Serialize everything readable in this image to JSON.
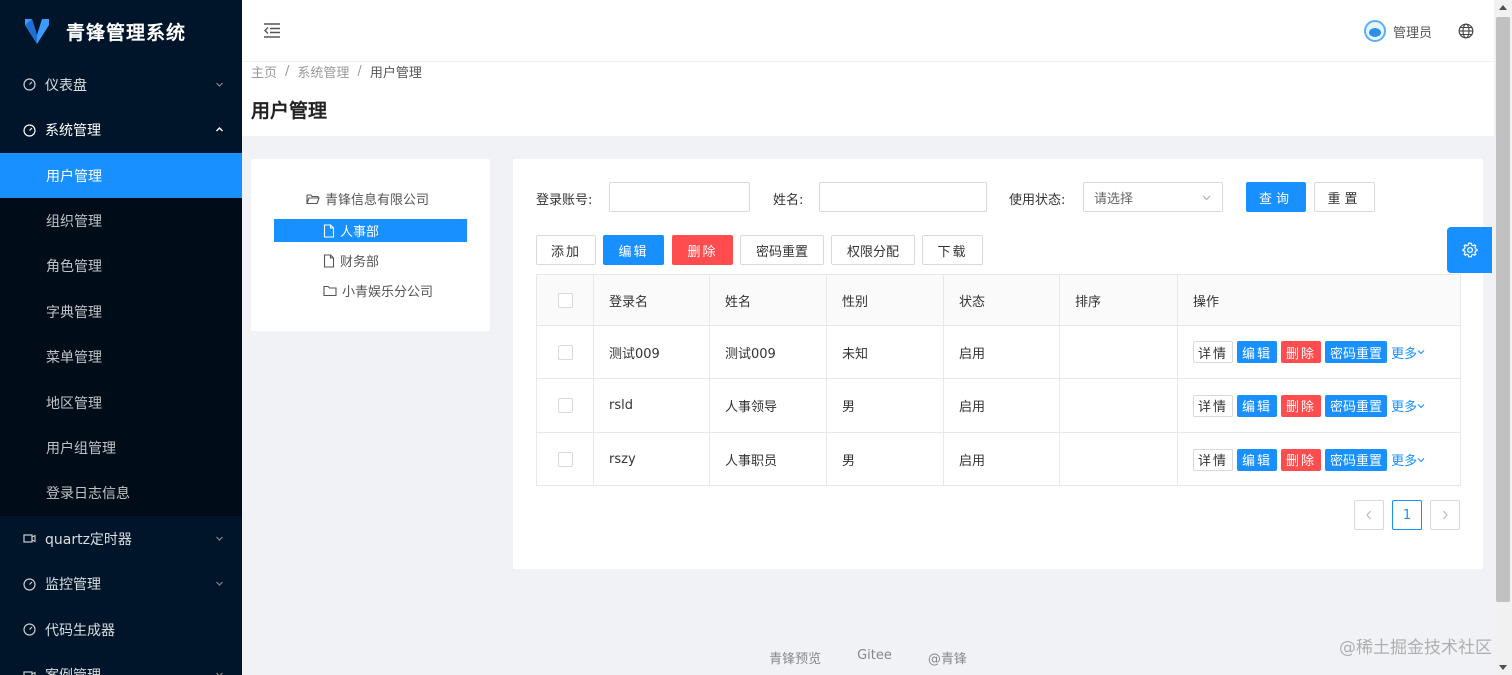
{
  "app": {
    "title": "青锋管理系统"
  },
  "sidebar": {
    "menus": [
      {
        "label": "仪表盘",
        "icon": "dashboard-icon",
        "expanded": false
      },
      {
        "label": "系统管理",
        "icon": "dashboard-icon",
        "expanded": true,
        "children": [
          "用户管理",
          "组织管理",
          "角色管理",
          "字典管理",
          "菜单管理",
          "地区管理",
          "用户组管理",
          "登录日志信息"
        ],
        "active_child": "用户管理"
      },
      {
        "label": "quartz定时器",
        "icon": "video-icon",
        "expanded": false
      },
      {
        "label": "监控管理",
        "icon": "dashboard-icon",
        "expanded": false
      },
      {
        "label": "代码生成器",
        "icon": "dashboard-icon",
        "expanded": false
      },
      {
        "label": "案例管理",
        "icon": "video-icon",
        "expanded": false
      }
    ]
  },
  "header": {
    "user_name": "管理员"
  },
  "breadcrumb": [
    "主页",
    "系统管理",
    "用户管理"
  ],
  "page_title": "用户管理",
  "tree": {
    "root": "青锋信息有限公司",
    "children": [
      "人事部",
      "财务部",
      "小青娱乐分公司"
    ],
    "selected": "人事部"
  },
  "search": {
    "account_label": "登录账号:",
    "account_value": "",
    "name_label": "姓名:",
    "name_value": "",
    "status_label": "使用状态:",
    "status_placeholder": "请选择",
    "query_label": "查询",
    "reset_label": "重置"
  },
  "toolbar": {
    "add_label": "添加",
    "edit_label": "编辑",
    "delete_label": "删除",
    "reset_pwd_label": "密码重置",
    "permission_label": "权限分配",
    "download_label": "下载"
  },
  "table": {
    "columns": [
      "登录名",
      "姓名",
      "性别",
      "状态",
      "排序",
      "操作"
    ],
    "rows": [
      {
        "login": "测试009",
        "name": "测试009",
        "gender": "未知",
        "status": "启用",
        "sort": ""
      },
      {
        "login": "rsld",
        "name": "人事领导",
        "gender": "男",
        "status": "启用",
        "sort": ""
      },
      {
        "login": "rszy",
        "name": "人事职员",
        "gender": "男",
        "status": "启用",
        "sort": ""
      }
    ],
    "actions": {
      "detail": "详情",
      "edit": "编辑",
      "delete": "删除",
      "reset_pwd": "密码重置",
      "more": "更多"
    }
  },
  "pagination": {
    "current": "1"
  },
  "footer": {
    "links": [
      "青锋预览",
      "Gitee",
      "@青锋"
    ]
  },
  "watermark": "@稀土掘金技术社区",
  "colors": {
    "primary": "#1890ff",
    "danger": "#ff4d4f",
    "sidebar_bg": "#001529",
    "sidebar_sub_bg": "#000c17"
  }
}
